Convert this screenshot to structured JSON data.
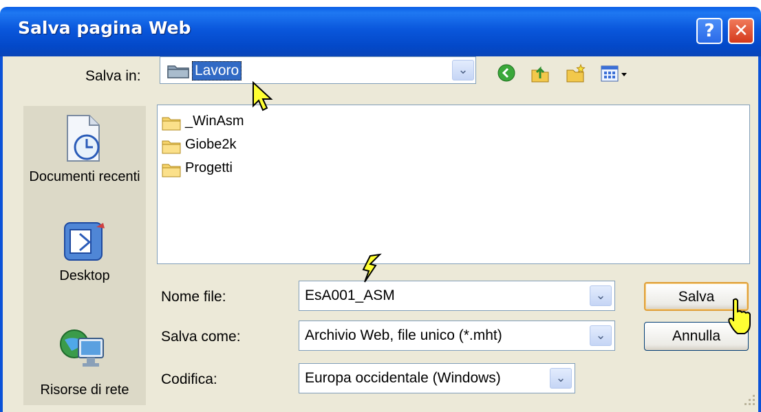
{
  "window": {
    "title": "Salva pagina Web",
    "help_glyph": "?",
    "close_glyph": "✕"
  },
  "save_in": {
    "label": "Salva in:",
    "value": "Lavoro"
  },
  "toolbar": {
    "icons": [
      "back-icon",
      "up-folder-icon",
      "new-folder-icon",
      "view-menu-icon"
    ]
  },
  "places": [
    {
      "label": "Documenti recenti",
      "icon": "recent-documents-icon"
    },
    {
      "label": "Desktop",
      "icon": "desktop-icon"
    },
    {
      "label": "Risorse di rete",
      "icon": "network-icon"
    }
  ],
  "files": [
    "_WinAsm",
    "Giobe2k",
    "Progetti"
  ],
  "filename": {
    "label": "Nome file:",
    "value": "EsA001_ASM"
  },
  "save_as": {
    "label": "Salva come:",
    "value": "Archivio Web, file unico (*.mht)"
  },
  "encoding": {
    "label": "Codifica:",
    "value": "Europa occidentale (Windows)"
  },
  "buttons": {
    "save": "Salva",
    "cancel": "Annulla"
  },
  "colors": {
    "title_bar": "#0a57dc",
    "dialog_bg": "#ece9d8",
    "selection": "#316ac5",
    "cursor": "#ffff33"
  }
}
